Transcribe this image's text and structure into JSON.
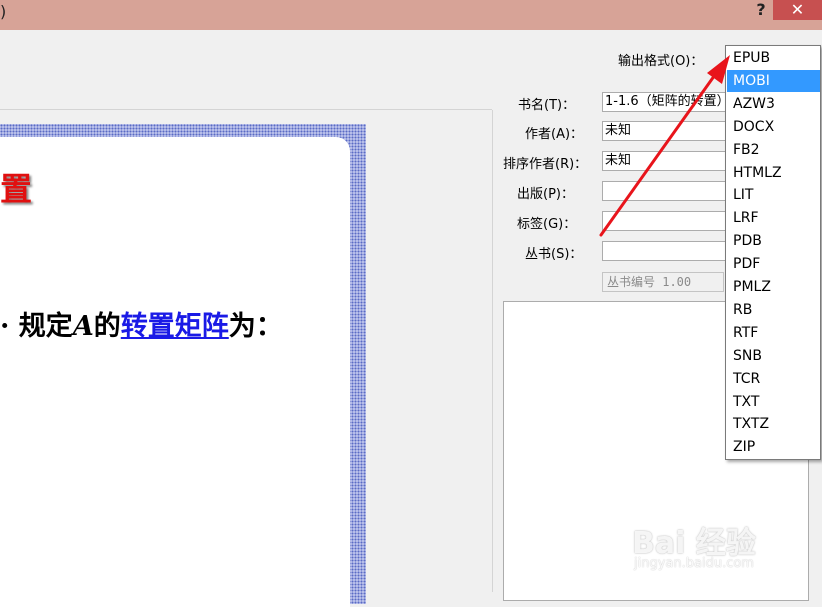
{
  "titlebar": {
    "title_fragment": ")",
    "help_label": "?",
    "close_label": "✕"
  },
  "cover": {
    "title_fragment": "置",
    "line": {
      "lead": "· 规定",
      "var": "A",
      "mid": "的",
      "link": "转置矩阵",
      "tail": "为："
    }
  },
  "form": {
    "output_format_label": "输出格式(O)：",
    "title_label": "书名(T)：",
    "title_value": "1-1.6（矩阵的转置）",
    "author_label": "作者(A)：",
    "author_value": "未知",
    "author_sort_label": "排序作者(R)：",
    "author_sort_value": "未知",
    "publisher_label": "出版(P)：",
    "publisher_value": "",
    "tags_label": "标签(G)：",
    "tags_value": "",
    "series_label": "丛书(S)：",
    "series_value": "",
    "series_number": "丛书编号 1.00"
  },
  "dropdown": {
    "selected": "MOBI",
    "options": [
      "EPUB",
      "MOBI",
      "AZW3",
      "DOCX",
      "FB2",
      "HTMLZ",
      "LIT",
      "LRF",
      "PDB",
      "PDF",
      "PMLZ",
      "RB",
      "RTF",
      "SNB",
      "TCR",
      "TXT",
      "TXTZ",
      "ZIP"
    ]
  },
  "colors": {
    "titlebar": "#d7a397",
    "close": "#c75050",
    "selection": "#3399ff",
    "arrow": "#e8141b",
    "cover_title": "#e01010",
    "cover_link": "#1a1ae6"
  },
  "watermark": {
    "brand": "Bai 经验",
    "url": "jingyan.baidu.com"
  }
}
